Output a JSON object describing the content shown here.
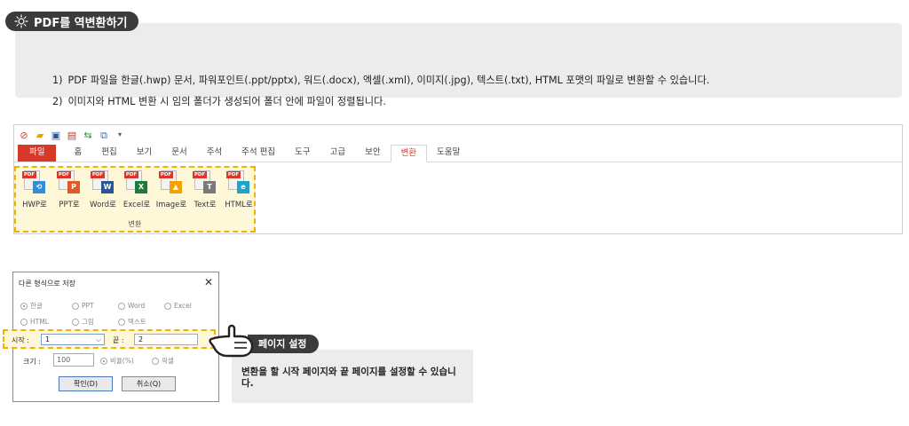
{
  "tip": {
    "title": "PDF를 역변환하기",
    "lines": [
      {
        "num": "1)",
        "text": "PDF 파일을 한글(.hwp) 문서, 파워포인트(.ppt/pptx), 워드(.docx), 엑셀(.xml), 이미지(.jpg), 텍스트(.txt), HTML 포맷의 파일로 변환할 수 있습니다."
      },
      {
        "num": "2)",
        "text": "이미지와 HTML 변환 시 임의 폴더가 생성되어 폴더 안에 파일이 정렬됩니다."
      }
    ]
  },
  "ribbon": {
    "tabs": [
      "파일",
      "홈",
      "편집",
      "보기",
      "문서",
      "주석",
      "주석 편집",
      "도구",
      "고급",
      "보안",
      "변환",
      "도움말"
    ],
    "active_tab": "변환",
    "group_label": "변환",
    "commands": [
      {
        "label": "HWP로",
        "icon": "hwp-convert-icon",
        "color": "#2f8fd8",
        "glyph": "⟲"
      },
      {
        "label": "PPT로",
        "icon": "ppt-convert-icon",
        "color": "#e05a26",
        "glyph": "P"
      },
      {
        "label": "Word로",
        "icon": "word-convert-icon",
        "color": "#2a5699",
        "glyph": "W"
      },
      {
        "label": "Excel로",
        "icon": "excel-convert-icon",
        "color": "#1e7a3e",
        "glyph": "X"
      },
      {
        "label": "Image로",
        "icon": "image-convert-icon",
        "color": "#f2a100",
        "glyph": "▲"
      },
      {
        "label": "Text로",
        "icon": "text-convert-icon",
        "color": "#7a7a7a",
        "glyph": "T"
      },
      {
        "label": "HTML로",
        "icon": "html-convert-icon",
        "color": "#1fa3c8",
        "glyph": "e"
      }
    ]
  },
  "dialog": {
    "title": "다른 형식으로 저장",
    "formats_row1": [
      "한글",
      "PPT",
      "Word",
      "Excel"
    ],
    "formats_row2": [
      "HTML",
      "그림",
      "텍스트"
    ],
    "start_label": "시작 :",
    "start_value": "1",
    "end_label": "끝 :",
    "end_value": "2",
    "size_label": "크기 :",
    "size_value": "100",
    "size_opt1": "비율(%)",
    "size_opt2": "픽셀",
    "ok": "확인(D)",
    "cancel": "취소(Q)"
  },
  "callout": {
    "tag": "페이지 설정",
    "text": "변환을 할 시작 페이지와 끝 페이지를 설정할 수 있습니다."
  },
  "colors": {
    "accent": "#d8382a",
    "highlight": "#f0b400",
    "dark": "#3b3b3b"
  }
}
